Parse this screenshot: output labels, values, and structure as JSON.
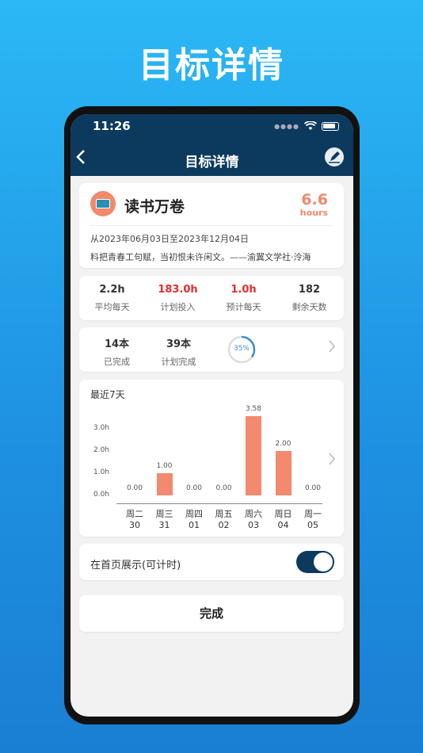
{
  "headline": "目标详情",
  "status": {
    "time": "11:26"
  },
  "nav": {
    "back_icon": "chevron-left-icon",
    "title": "目标详情",
    "edit_icon": "edit-icon"
  },
  "goal": {
    "title": "读书万卷",
    "hours_value": "6.6",
    "hours_unit": "hours",
    "date_range": "从2023年06月03日至2023年12月04日",
    "quote": "料把青春工句赋，当初恨未许闲文。——渝翼文学社·泠海",
    "accent_color": "#f08a6b"
  },
  "stats": [
    {
      "value": "2.2h",
      "label": "平均每天"
    },
    {
      "value": "183.0h",
      "label": "计划投入"
    },
    {
      "value": "1.0h",
      "label": "预计每天"
    },
    {
      "value": "182",
      "label": "剩余天数"
    }
  ],
  "progress": {
    "completed_value": "14本",
    "completed_label": "已完成",
    "plan_value": "39本",
    "plan_label": "计划完成",
    "percent_label": "35%",
    "percent": 35
  },
  "chart_title": "最近7天",
  "chart_data": {
    "type": "bar",
    "title": "最近7天",
    "categories": [
      "周二 30",
      "周三 31",
      "周四 01",
      "周五 02",
      "周六 03",
      "周日 04",
      "周一 05"
    ],
    "day_names": [
      "周二",
      "周三",
      "周四",
      "周五",
      "周六",
      "周日",
      "周一"
    ],
    "day_nums": [
      "30",
      "31",
      "01",
      "02",
      "03",
      "04",
      "05"
    ],
    "values": [
      0.0,
      1.0,
      0.0,
      0.0,
      3.58,
      2.0,
      0.0
    ],
    "value_labels": [
      "0.00",
      "1.00",
      "0.00",
      "0.00",
      "3.58",
      "2.00",
      "0.00"
    ],
    "yticks": [
      "3.0h",
      "2.0h",
      "1.0h",
      "0.0h"
    ],
    "ylim": [
      0,
      3.58
    ],
    "grid": false,
    "bar_color": "#f38a70"
  },
  "homepage_toggle": {
    "label": "在首页展示(可计时)",
    "on": true
  },
  "done_button": "完成"
}
